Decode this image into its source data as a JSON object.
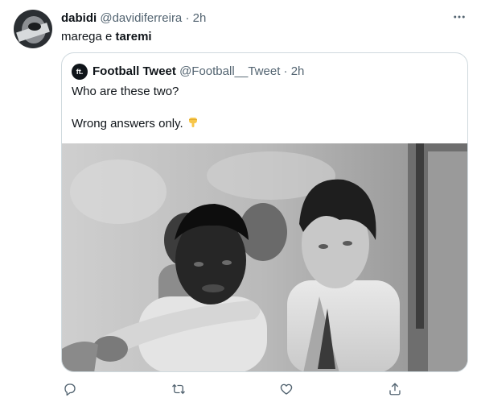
{
  "tweet": {
    "author_name": "dabidi",
    "author_handle": "@davidiferreira",
    "separator": "·",
    "time": "2h",
    "text_plain": "marega e ",
    "text_bold": "taremi"
  },
  "quote": {
    "avatar_text": "ft.",
    "author_name": "Football Tweet",
    "author_handle": "@Football__Tweet",
    "separator": "·",
    "time": "2h",
    "line1": "Who are these two?",
    "line2": "Wrong answers only.",
    "emoji_name": "backhand-index-pointing-down-icon"
  },
  "icons": {
    "more": "more-horizontal-icon",
    "reply": "reply-icon",
    "retweet": "retweet-icon",
    "like": "heart-icon",
    "share": "share-icon"
  },
  "colors": {
    "text": "#0f1419",
    "muted": "#536471",
    "border": "#cfd9de",
    "emoji": "#f7c64a"
  }
}
